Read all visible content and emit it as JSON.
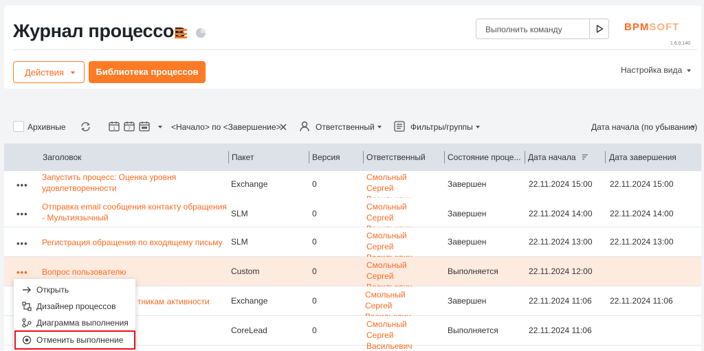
{
  "page": {
    "title": "Журнал процессов",
    "command_placeholder": "Выполнить команду",
    "logo_part1": "BPM",
    "logo_part2": "SOFT",
    "version": "1.6.0.140",
    "actions_label": "Действия",
    "library_label": "Библиотека процессов",
    "view_settings_label": "Настройка вида"
  },
  "filters": {
    "archive_label": "Архивные",
    "period_label": "<Начало> по <Завершение>",
    "responsible_label": "Ответственный",
    "filters_groups_label": "Фильтры/группы",
    "sort_label": "Дата начала (по убыванию)"
  },
  "grid": {
    "columns": [
      "Заголовок",
      "Пакет",
      "Версия",
      "Ответственный",
      "Состояние проце...",
      "Дата начала",
      "Дата завершения"
    ],
    "rows": [
      {
        "title": "Запустить процесс: Оценка уровня удовлетворенности",
        "package": "Exchange",
        "version": "0",
        "responsible": "Смольный Сергей Васильевич",
        "state": "Завершен",
        "start": "22.11.2024 15:00",
        "end": "22.11.2024 15:00"
      },
      {
        "title": "Отправка email сообщения контакту обращения - Мультиязычный",
        "package": "SLM",
        "version": "0",
        "responsible": "Смольный Сергей Васильевич",
        "state": "Завершен",
        "start": "22.11.2024 14:00",
        "end": "22.11.2024 14:00"
      },
      {
        "title": "Регистрация обращения по входящему письму",
        "package": "SLM",
        "version": "0",
        "responsible": "Смольный Сергей Васильевич",
        "state": "Завершен",
        "start": "22.11.2024 13:00",
        "end": "22.11.2024 13:00"
      },
      {
        "title": "Вопрос пользователю",
        "package": "Custom",
        "version": "0",
        "responsible": "Смольный Сергей Васильевич",
        "state": "Выполняется",
        "start": "22.11.2024 12:00",
        "end": ""
      },
      {
        "title": "тникам активности",
        "package": "Exchange",
        "version": "0",
        "responsible": "Смольный Сергей Васильевич",
        "state": "Завершен",
        "start": "22.11.2024 11:06",
        "end": "22.11.2024 11:06"
      },
      {
        "title": "",
        "package": "CoreLead",
        "version": "0",
        "responsible": "Смольный Сергей Васильевич",
        "state": "Выполняется",
        "start": "22.11.2024 11:06",
        "end": ""
      }
    ]
  },
  "context_menu": {
    "items": [
      {
        "label": "Открыть",
        "icon": "arrow-right-icon"
      },
      {
        "label": "Дизайнер процессов",
        "icon": "process-designer-icon"
      },
      {
        "label": "Диаграмма выполнения",
        "icon": "execution-diagram-icon"
      },
      {
        "label": "Отменить выполнение",
        "icon": "cancel-execution-icon"
      }
    ]
  },
  "colors": {
    "accent": "#ff7a25",
    "highlight_row": "#fdebe0",
    "grid_header": "#dde1e8",
    "annotation_box": "#e8101a"
  }
}
